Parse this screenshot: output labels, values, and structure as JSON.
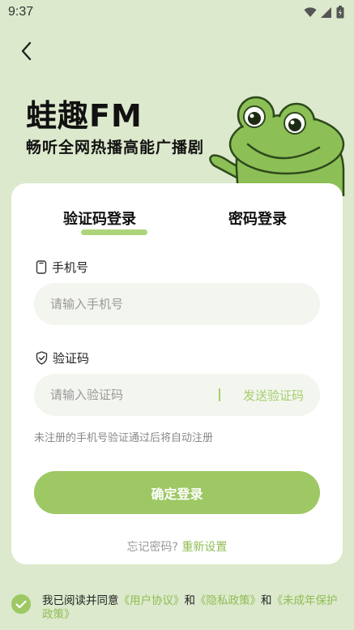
{
  "status_bar": {
    "time": "9:37"
  },
  "hero": {
    "title": "蛙趣FM",
    "subtitle": "畅听全网热播高能广播剧"
  },
  "tabs": [
    {
      "label": "验证码登录",
      "active": true
    },
    {
      "label": "密码登录",
      "active": false
    }
  ],
  "phone": {
    "label": "手机号",
    "placeholder": "请输入手机号",
    "value": ""
  },
  "code": {
    "label": "验证码",
    "placeholder": "请输入验证码",
    "value": "",
    "send_label": "发送验证码"
  },
  "hint": "未注册的手机号验证通过后将自动注册",
  "login_button": "确定登录",
  "forgot": {
    "text": "忘记密码?",
    "reset_label": "重新设置"
  },
  "agreement": {
    "checked": true,
    "prefix": "我已阅读并同意",
    "user_agreement": "《用户协议》",
    "and1": "和",
    "privacy_policy": "《隐私政策》",
    "and2": "和",
    "minor_policy": "《未成年保护政策》"
  },
  "colors": {
    "background": "#dce9cc",
    "accent": "#9dc863",
    "card": "#ffffff"
  },
  "icons": [
    "back-arrow-icon",
    "wifi-icon",
    "signal-icon",
    "battery-icon",
    "phone-icon",
    "shield-check-icon",
    "check-icon",
    "frog-mascot-icon"
  ]
}
